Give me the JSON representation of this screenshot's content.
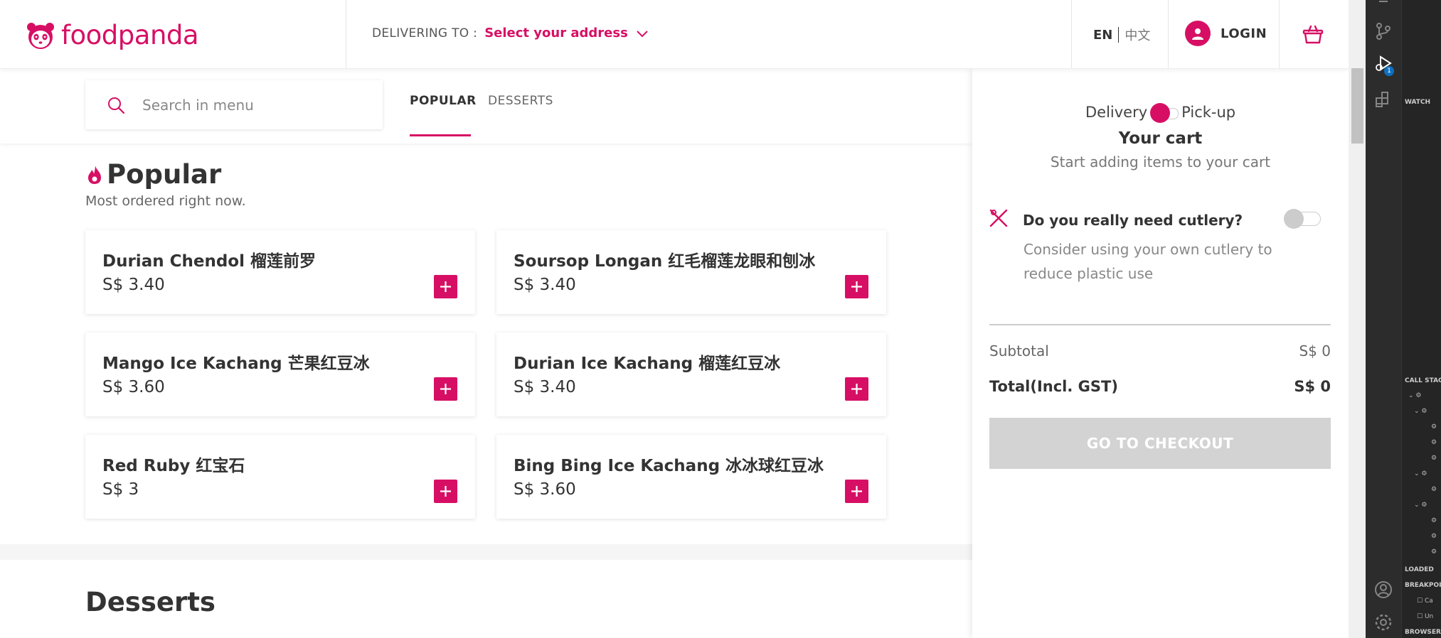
{
  "header": {
    "brand": "foodpanda",
    "delivering_label": "DELIVERING TO :",
    "address_label": "Select your address",
    "lang_en": "EN",
    "lang_zh": "中文",
    "login_label": "LOGIN"
  },
  "search": {
    "placeholder": "Search in menu",
    "value": ""
  },
  "tabs": [
    {
      "label": "POPULAR",
      "active": true
    },
    {
      "label": "DESSERTS",
      "active": false
    }
  ],
  "popular": {
    "title": "Popular",
    "subtitle": "Most ordered right now.",
    "items": [
      {
        "name": "Durian Chendol 榴莲前罗",
        "price": "S$ 3.40"
      },
      {
        "name": "Soursop Longan 红毛榴莲龙眼和刨冰",
        "price": "S$ 3.40"
      },
      {
        "name": "Mango Ice Kachang 芒果红豆冰",
        "price": "S$ 3.60"
      },
      {
        "name": "Durian Ice Kachang 榴莲红豆冰",
        "price": "S$ 3.40"
      },
      {
        "name": "Red Ruby 红宝石",
        "price": "S$ 3"
      },
      {
        "name": "Bing Bing Ice Kachang 冰冰球红豆冰",
        "price": "S$ 3.60"
      }
    ]
  },
  "desserts": {
    "title": "Desserts"
  },
  "cart": {
    "mode_delivery": "Delivery",
    "mode_pickup": "Pick-up",
    "title": "Your cart",
    "subtitle": "Start adding items to your cart",
    "cutlery_title": "Do you really need cutlery?",
    "cutlery_desc": "Consider using your own cutlery to reduce plastic use",
    "subtotal_label": "Subtotal",
    "subtotal_value": "S$ 0",
    "total_label": "Total(Incl. GST)",
    "total_value": "S$ 0",
    "checkout_label": "GO TO CHECKOUT"
  },
  "ide": {
    "debug_badge": "1",
    "sections": [
      "WATCH",
      "CALL STACK",
      "LOADED",
      "BREAKPOINTS",
      "BROWSER"
    ],
    "breakpoint_items": [
      "Ca",
      "Un"
    ]
  },
  "colors": {
    "brand": "#d70f64",
    "checkout_disabled": "#d3d3d3"
  }
}
